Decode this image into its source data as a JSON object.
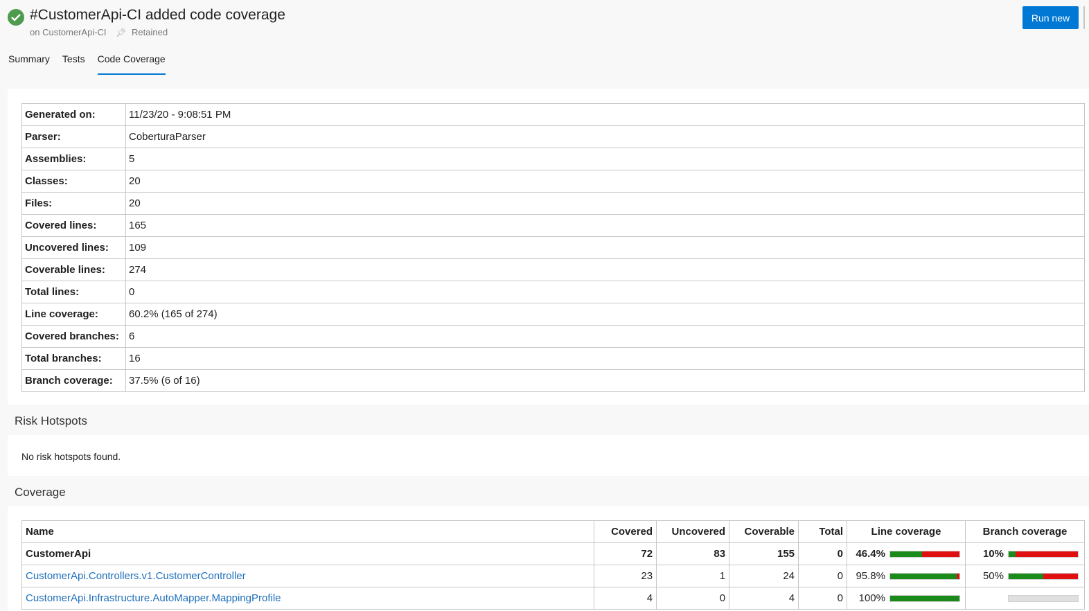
{
  "header": {
    "title": "#CustomerApi-CI added code coverage",
    "pipeline": "on CustomerApi-CI",
    "retained": "Retained",
    "run_new": "Run new"
  },
  "tabs": [
    {
      "label": "Summary"
    },
    {
      "label": "Tests"
    },
    {
      "label": "Code Coverage",
      "active": true
    }
  ],
  "summary": {
    "rows": [
      {
        "key": "Generated on:",
        "value": "11/23/20 - 9:08:51 PM"
      },
      {
        "key": "Parser:",
        "value": "CoberturaParser"
      },
      {
        "key": "Assemblies:",
        "value": "5"
      },
      {
        "key": "Classes:",
        "value": "20"
      },
      {
        "key": "Files:",
        "value": "20"
      },
      {
        "key": "Covered lines:",
        "value": "165"
      },
      {
        "key": "Uncovered lines:",
        "value": "109"
      },
      {
        "key": "Coverable lines:",
        "value": "274"
      },
      {
        "key": "Total lines:",
        "value": "0"
      },
      {
        "key": "Line coverage:",
        "value": "60.2% (165 of 274)"
      },
      {
        "key": "Covered branches:",
        "value": "6"
      },
      {
        "key": "Total branches:",
        "value": "16"
      },
      {
        "key": "Branch coverage:",
        "value": "37.5% (6 of 16)"
      }
    ]
  },
  "risk": {
    "title": "Risk Hotspots",
    "message": "No risk hotspots found."
  },
  "coverage": {
    "title": "Coverage",
    "headers": {
      "name": "Name",
      "covered": "Covered",
      "uncovered": "Uncovered",
      "coverable": "Coverable",
      "total": "Total",
      "line": "Line coverage",
      "branch": "Branch coverage"
    },
    "rows": [
      {
        "name": "CustomerApi",
        "covered": "72",
        "uncovered": "83",
        "coverable": "155",
        "total": "0",
        "line_pct": "46.4%",
        "line_fraction": 0.464,
        "branch_pct": "10%",
        "branch_fraction": 0.1
      },
      {
        "name": "CustomerApi.Controllers.v1.CustomerController",
        "covered": "23",
        "uncovered": "1",
        "coverable": "24",
        "total": "0",
        "line_pct": "95.8%",
        "line_fraction": 0.958,
        "branch_pct": "50%",
        "branch_fraction": 0.5
      },
      {
        "name": "CustomerApi.Infrastructure.AutoMapper.MappingProfile",
        "covered": "4",
        "uncovered": "0",
        "coverable": "4",
        "total": "0",
        "line_pct": "100%",
        "line_fraction": 1.0,
        "branch_pct": "",
        "branch_fraction": null
      }
    ]
  },
  "colors": {
    "accent": "#0078d4",
    "success": "#4f9a4f",
    "covered_bar": "#1a8a1a",
    "uncovered_bar": "#e01010",
    "link": "#1e6fba"
  }
}
